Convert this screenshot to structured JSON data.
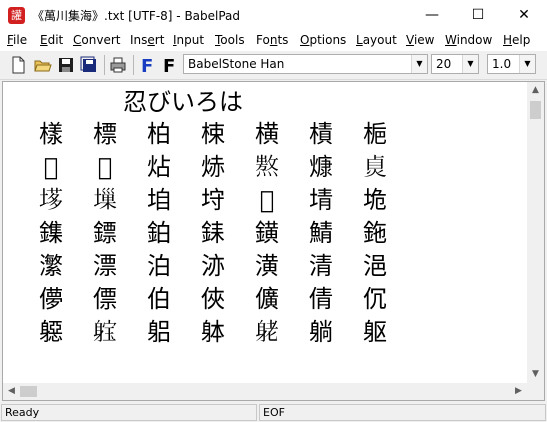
{
  "window": {
    "title": "《萬川集海》.txt [UTF-8] - BabelPad",
    "app_icon_glyph": "讙",
    "minimize": "—",
    "maximize": "☐",
    "close": "✕"
  },
  "menu": {
    "items": [
      {
        "key": "F",
        "rest": "ile"
      },
      {
        "key": "E",
        "rest": "dit"
      },
      {
        "key": "C",
        "rest": "onvert"
      },
      {
        "key": "",
        "pre": "Ins",
        "key2": "e",
        "rest": "rt"
      },
      {
        "key": "I",
        "rest": "nput"
      },
      {
        "key": "T",
        "rest": "ools"
      },
      {
        "pre": "Fo",
        "key": "n",
        "rest": "ts"
      },
      {
        "key": "O",
        "rest": "ptions"
      },
      {
        "key": "L",
        "rest": "ayout"
      },
      {
        "key": "V",
        "rest": "iew"
      },
      {
        "key": "W",
        "rest": "indow"
      },
      {
        "key": "H",
        "rest": "elp"
      }
    ]
  },
  "toolbar": {
    "font_name": "BabelStone Han",
    "font_size": "20",
    "line_spacing": "1.0",
    "bold_font_button": "F",
    "font_button": "F"
  },
  "document": {
    "title_line": "忍びいろは",
    "rows": [
      [
        "樣",
        "標",
        "柏",
        "梀",
        "横",
        "樍",
        "梔"
      ],
      [
        "𤏋",
        "𤏖",
        "炶",
        "焃",
        "𤏺",
        "𤎖",
        "𤈱"
      ],
      [
        "𡏗",
        "𡏮",
        "垍",
        "垨",
        "𡏿",
        "埥",
        "垝"
      ],
      [
        "鏶",
        "鏢",
        "鉑",
        "銇",
        "鐄",
        "鯖",
        "鉇"
      ],
      [
        "瀿",
        "漂",
        "泊",
        "洂",
        "潢",
        "清",
        "浥"
      ],
      [
        "儚",
        "僄",
        "伯",
        "俠",
        "儣",
        "倩",
        "伔"
      ],
      [
        "𨉼",
        "𨉗",
        "躳",
        "躰",
        "𨈺",
        "躺",
        "躯"
      ]
    ]
  },
  "status": {
    "left": "Ready",
    "middle": "EOF"
  },
  "colors": {
    "accent_blue": "#1a3cc0",
    "app_icon_red": "#d21f1f"
  }
}
